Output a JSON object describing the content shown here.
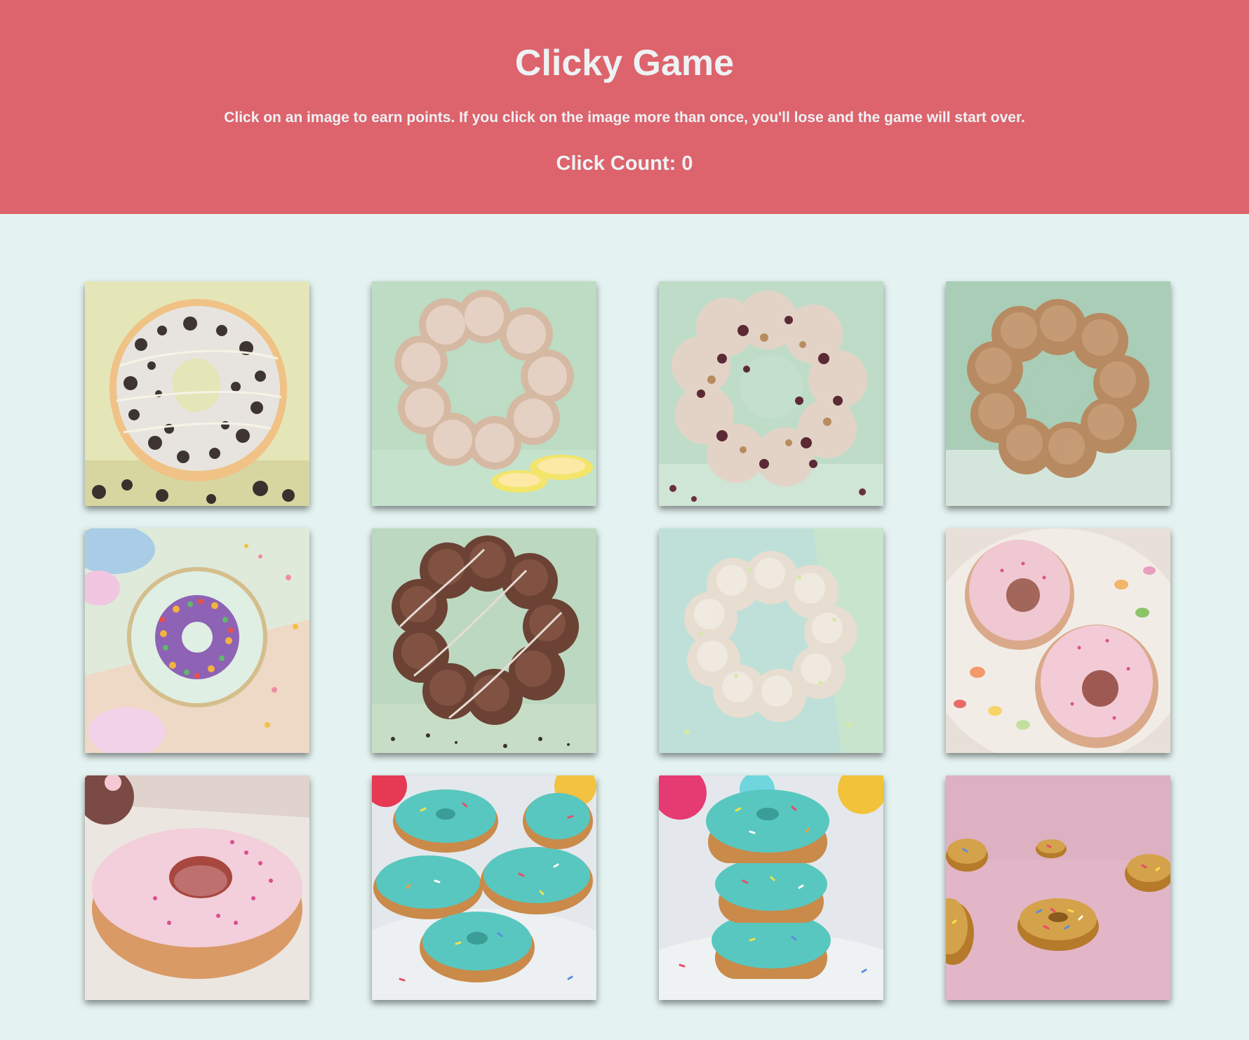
{
  "header": {
    "title": "Clicky Game",
    "instructions": "Click on an image to earn points. If you click on the image more than once, you'll lose and the game will start over.",
    "count_label": "Click Count: 0"
  },
  "colors": {
    "header_bg": "#dd636c",
    "page_bg": "#e4f3f1",
    "header_text": "#eef2f4"
  },
  "images": [
    {
      "subject": "cookies-and-cream-pon-de-ring-donut"
    },
    {
      "subject": "lemon-glazed-pon-de-ring-donut"
    },
    {
      "subject": "glazed-nut-topped-pon-de-ring-donut"
    },
    {
      "subject": "cinnamon-sugar-pon-de-ring-donut"
    },
    {
      "subject": "purple-cereal-topped-donut-on-plate"
    },
    {
      "subject": "chocolate-drizzle-pon-de-ring-donut"
    },
    {
      "subject": "matcha-sugar-pon-de-ring-donut"
    },
    {
      "subject": "pink-glazed-crullers-with-jelly-beans"
    },
    {
      "subject": "pink-glazed-cruller-with-sprinkles"
    },
    {
      "subject": "teal-frosted-donut-pile-with-sprinkles"
    },
    {
      "subject": "teal-frosted-donut-stack-with-sprinkles"
    },
    {
      "subject": "gold-donuts-with-sprinkles-on-pink"
    }
  ]
}
